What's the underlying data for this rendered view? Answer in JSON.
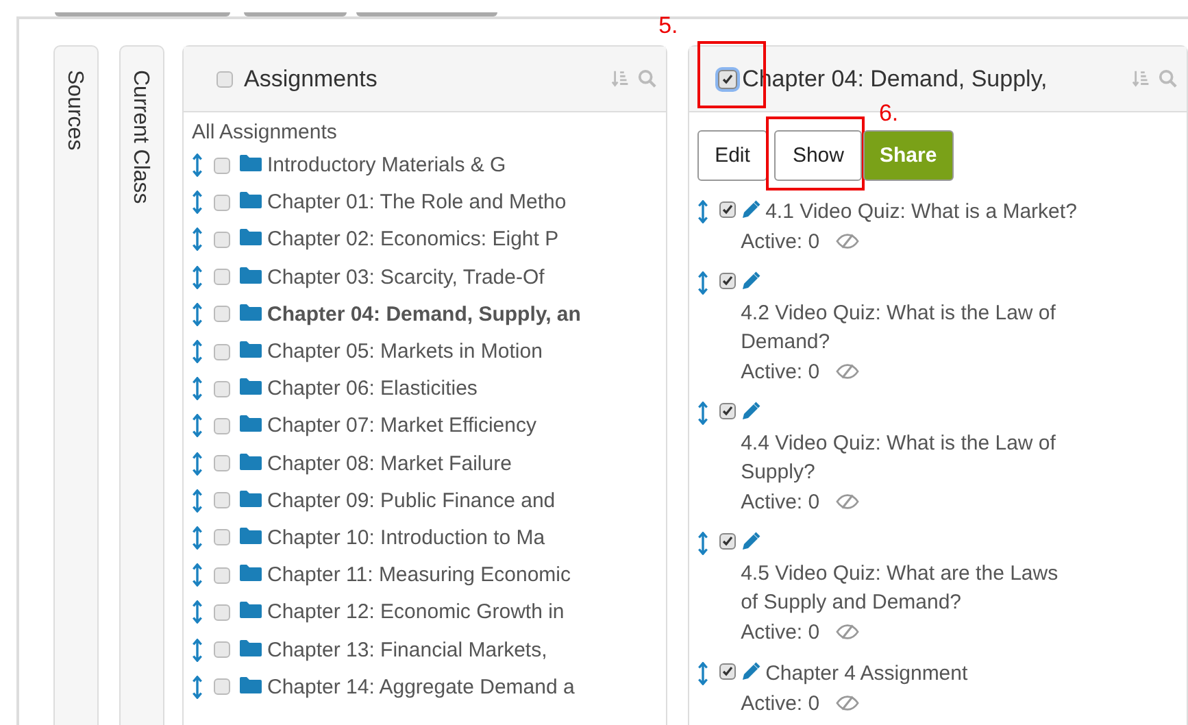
{
  "side_tabs": [
    {
      "label": "Sources"
    },
    {
      "label": "Current Class"
    }
  ],
  "assignments_panel": {
    "title": "Assignments",
    "checked": false,
    "group_label": "All Assignments",
    "items": [
      {
        "title": "Introductory Materials & G",
        "checked": false,
        "selected": false
      },
      {
        "title": "Chapter 01: The Role and Metho",
        "checked": false,
        "selected": false
      },
      {
        "title": "Chapter 02: Economics: Eight P",
        "checked": false,
        "selected": false
      },
      {
        "title": "Chapter 03: Scarcity, Trade-Of",
        "checked": false,
        "selected": false
      },
      {
        "title": "Chapter 04: Demand, Supply, an",
        "checked": false,
        "selected": true
      },
      {
        "title": "Chapter 05: Markets in Motion",
        "checked": false,
        "selected": false
      },
      {
        "title": "Chapter 06: Elasticities",
        "checked": false,
        "selected": false
      },
      {
        "title": "Chapter 07: Market Efficiency",
        "checked": false,
        "selected": false
      },
      {
        "title": "Chapter 08: Market Failure",
        "checked": false,
        "selected": false
      },
      {
        "title": "Chapter 09: Public Finance and",
        "checked": false,
        "selected": false
      },
      {
        "title": "Chapter 10: Introduction to Ma",
        "checked": false,
        "selected": false
      },
      {
        "title": "Chapter 11: Measuring Economic",
        "checked": false,
        "selected": false
      },
      {
        "title": "Chapter 12: Economic Growth in",
        "checked": false,
        "selected": false
      },
      {
        "title": "Chapter 13: Financial Markets,",
        "checked": false,
        "selected": false
      },
      {
        "title": "Chapter 14: Aggregate Demand a",
        "checked": false,
        "selected": false
      }
    ]
  },
  "chapter_panel": {
    "title": "Chapter 04: Demand, Supply,",
    "checked": true,
    "annotation": "5.",
    "buttons": [
      {
        "label": "Edit",
        "kind": "outline"
      },
      {
        "label": "Show",
        "kind": "outline",
        "annotation": "6."
      },
      {
        "label": "Share",
        "kind": "primary"
      }
    ],
    "items": [
      {
        "title": "4.1 Video Quiz: What is a Market?",
        "checked": true,
        "status": "Active: 0"
      },
      {
        "title": "4.2 Video Quiz: What is the Law of Demand?",
        "checked": true,
        "status": "Active: 0"
      },
      {
        "title": "4.4 Video Quiz: What is the Law of Supply?",
        "checked": true,
        "status": "Active: 0"
      },
      {
        "title": "4.5 Video Quiz: What are the Laws of Supply and Demand?",
        "checked": true,
        "status": "Active: 0"
      },
      {
        "title": "Chapter 4 Assignment",
        "checked": true,
        "status": "Active: 0"
      }
    ]
  }
}
